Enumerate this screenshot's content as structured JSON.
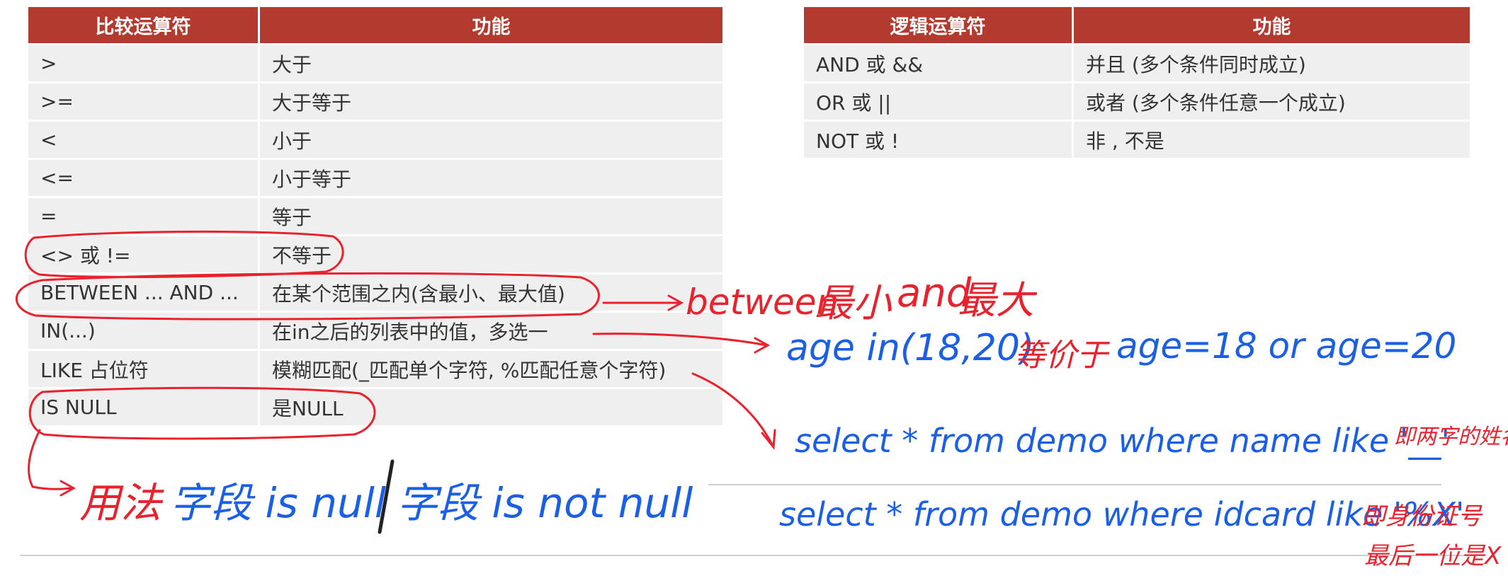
{
  "comparison_table": {
    "headers": [
      "比较运算符",
      "功能"
    ],
    "rows": [
      {
        "op": ">",
        "desc": "大于"
      },
      {
        "op": ">=",
        "desc": "大于等于"
      },
      {
        "op": "<",
        "desc": "小于"
      },
      {
        "op": "<=",
        "desc": "小于等于"
      },
      {
        "op": "=",
        "desc": "等于"
      },
      {
        "op": "<> 或 !=",
        "desc": "不等于"
      },
      {
        "op": "BETWEEN ... AND ...",
        "desc": "在某个范围之内(含最小、最大值)"
      },
      {
        "op": "IN(...)",
        "desc": "在in之后的列表中的值，多选一"
      },
      {
        "op": "LIKE  占位符",
        "desc": "模糊匹配(_匹配单个字符, %匹配任意个字符)"
      },
      {
        "op": "IS NULL",
        "desc": "是NULL"
      }
    ]
  },
  "logic_table": {
    "headers": [
      "逻辑运算符",
      "功能"
    ],
    "rows": [
      {
        "op": "AND  或  &&",
        "desc": "并且 (多个条件同时成立)"
      },
      {
        "op": "OR  或  ||",
        "desc": "或者 (多个条件任意一个成立)"
      },
      {
        "op": "NOT  或  !",
        "desc": "非 , 不是"
      }
    ]
  },
  "annotations": {
    "between_en1": "between",
    "between_cn1": "最小",
    "between_en2": "and",
    "between_cn2": "最大",
    "in_part1": "age in(18,20)",
    "in_part2": "等价于",
    "in_part3": "age=18 or age=20",
    "like1_sql": "select * from demo where name like '__'",
    "like1_note": "即两字的姓名",
    "like2_sql": "select * from demo where idcard like '%X'",
    "like2_note1": "即身份证号",
    "like2_note2": "最后一位是X",
    "null_part1": "用法",
    "null_part2": "字段 is null",
    "null_part3": "字段 is not null"
  },
  "colors": {
    "header_bg": "#b23a2e",
    "row_bg": "#efefef",
    "ink_red": "#e8232d",
    "ink_blue": "#1a5fe6"
  }
}
